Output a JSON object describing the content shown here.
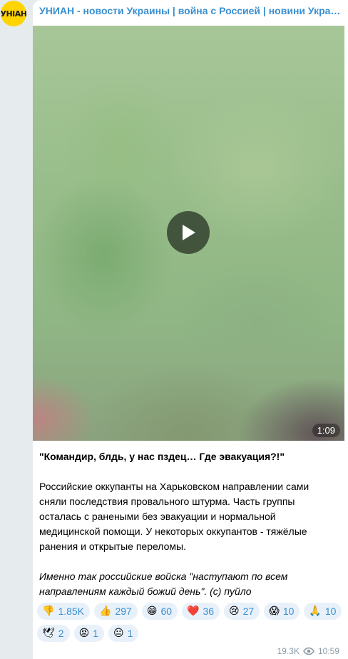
{
  "channel": {
    "name": "УНИАН - новости Украины | война с Россией | новини Україні...",
    "avatar_text": "УНIАН"
  },
  "video": {
    "duration": "1:09"
  },
  "message": {
    "headline": "\"Командир, блдь, у нас пздец… Где эвакуация?!\"",
    "body": "Российские оккупанты на Харьковском направлении сами сняли последствия провального штурма. Часть группы осталась с ранеными без эвакуации и нормальной медицинской помощи. У некоторых оккупантов - тяжёлые ранения и открытые переломы.",
    "italic": "Именно так российские войска \"наступают по всем направлениям каждый божий день\". (с) пуйло"
  },
  "reactions": [
    {
      "emoji": "👎",
      "count": "1.85K"
    },
    {
      "emoji": "👍",
      "count": "297"
    },
    {
      "emoji": "😁",
      "count": "60"
    },
    {
      "emoji": "❤️",
      "count": "36"
    },
    {
      "emoji": "😢",
      "count": "27"
    },
    {
      "emoji": "😱",
      "count": "10"
    },
    {
      "emoji": "🙏",
      "count": "10"
    },
    {
      "emoji": "🕊",
      "count": "2"
    },
    {
      "emoji": "😡",
      "count": "1"
    },
    {
      "emoji": "😐",
      "count": "1"
    }
  ],
  "meta": {
    "views": "19.3K",
    "time": "10:59"
  },
  "colors": {
    "accent": "#3a8fd0",
    "avatar_bg": "#ffd400",
    "reaction_bg": "#e8f1fa"
  }
}
